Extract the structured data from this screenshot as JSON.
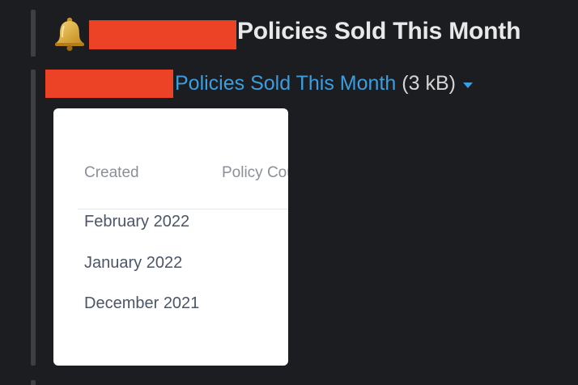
{
  "message": {
    "icon": "bell-icon",
    "title": "Policies Sold This Month"
  },
  "attachment": {
    "file_link": "Policies Sold This Month",
    "file_size": "(3 kB)",
    "dropdown_icon": "caret-down-icon"
  },
  "preview": {
    "columns": [
      "Created",
      "Policy Count"
    ],
    "rows": [
      "February 2022",
      "January 2022",
      "December 2021"
    ]
  },
  "colors": {
    "background": "#1b1d21",
    "redaction": "#ec4327",
    "link": "#3a9ee0",
    "title_text": "#e9e9ea"
  }
}
